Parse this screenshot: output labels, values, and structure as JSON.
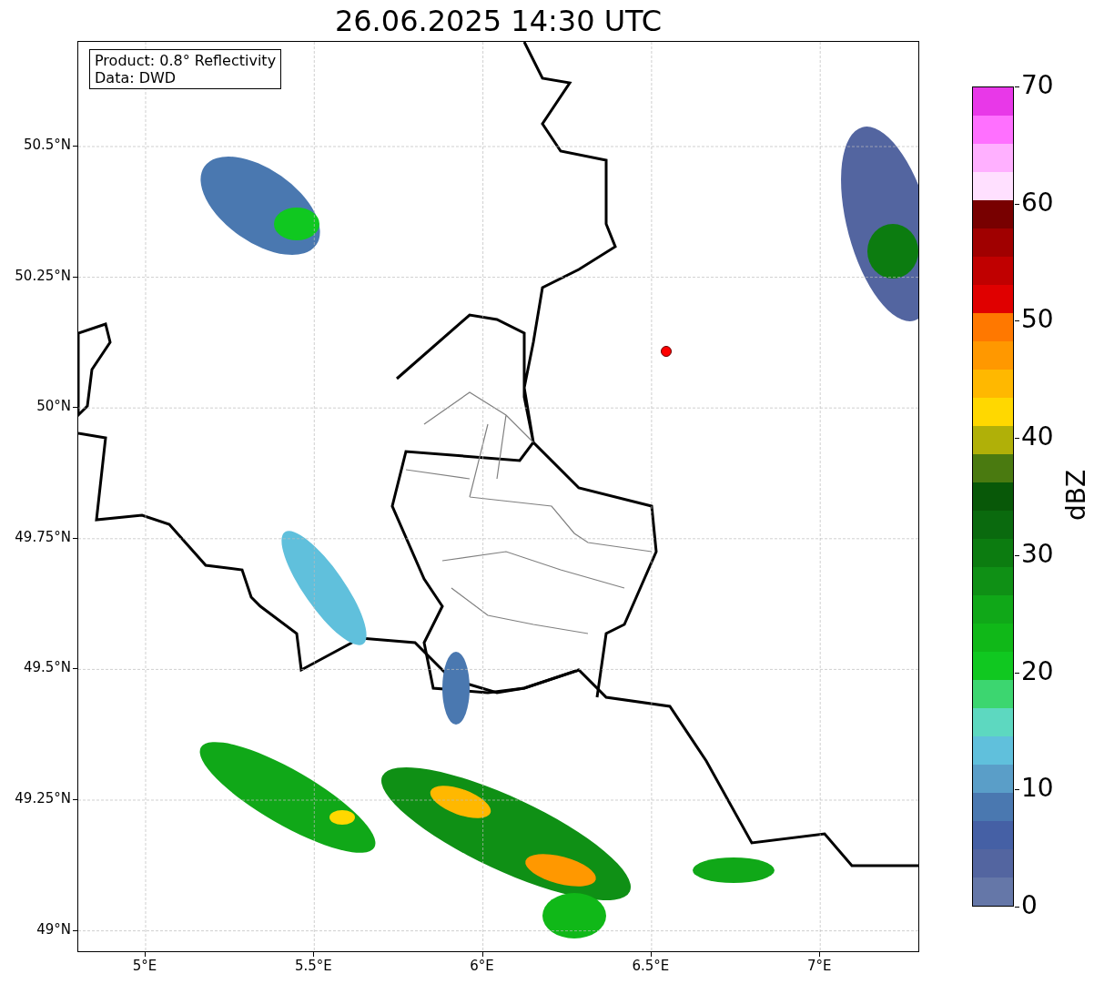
{
  "title": "26.06.2025 14:30 UTC",
  "map": {
    "legend": [
      "Product: 0.8° Reflectivity",
      "Data: DWD"
    ],
    "x_ticks": [
      "5°E",
      "5.5°E",
      "6°E",
      "6.5°E",
      "7°E"
    ],
    "y_ticks": [
      "50.5°N",
      "50.25°N",
      "50°N",
      "49.75°N",
      "49.5°N",
      "49.25°N",
      "49°N"
    ]
  },
  "colorbar": {
    "label": "dBZ",
    "ticks": [
      "70",
      "60",
      "50",
      "40",
      "30",
      "20",
      "10",
      "0"
    ],
    "segments": [
      {
        "color": "#e838e8"
      },
      {
        "color": "#ff70ff"
      },
      {
        "color": "#ffb0ff"
      },
      {
        "color": "#ffe0ff"
      },
      {
        "color": "#780000"
      },
      {
        "color": "#a00000"
      },
      {
        "color": "#c00000"
      },
      {
        "color": "#e00000"
      },
      {
        "color": "#ff7800"
      },
      {
        "color": "#ff9800"
      },
      {
        "color": "#ffb800"
      },
      {
        "color": "#ffd800"
      },
      {
        "color": "#b0b008"
      },
      {
        "color": "#4a7a10"
      },
      {
        "color": "#085808"
      },
      {
        "color": "#0a6a0e"
      },
      {
        "color": "#0c7c10"
      },
      {
        "color": "#0f9015"
      },
      {
        "color": "#10a818"
      },
      {
        "color": "#10b818"
      },
      {
        "color": "#10c820"
      },
      {
        "color": "#3cd670"
      },
      {
        "color": "#5dd8c0"
      },
      {
        "color": "#60c0dc"
      },
      {
        "color": "#5a9ec8"
      },
      {
        "color": "#4a78b0"
      },
      {
        "color": "#4560a5"
      },
      {
        "color": "#5365a0"
      },
      {
        "color": "#6577a8"
      }
    ]
  }
}
